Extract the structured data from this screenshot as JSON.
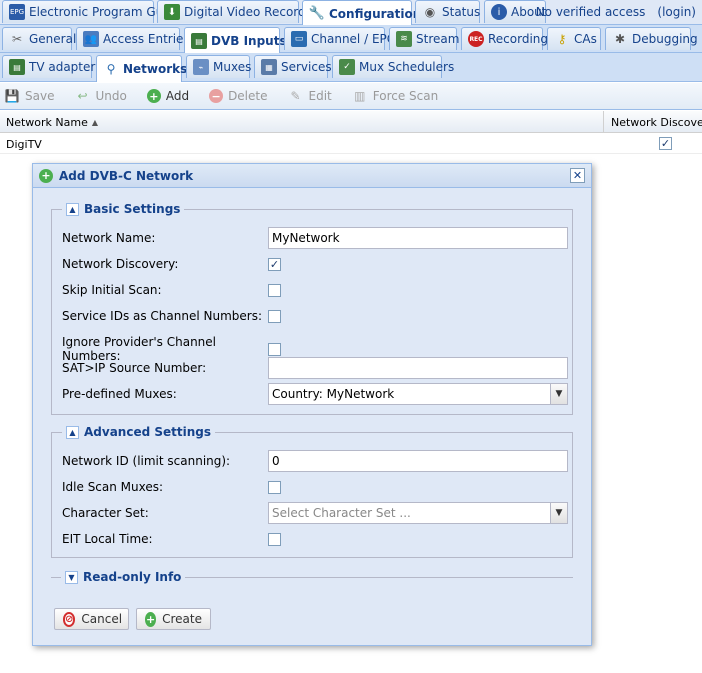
{
  "tabs_row1": [
    {
      "label": "Electronic Program Guide",
      "icon": "epg-icon"
    },
    {
      "label": "Digital Video Recorder",
      "icon": "download-icon"
    },
    {
      "label": "Configuration",
      "icon": "wrench-icon",
      "active": true
    },
    {
      "label": "Status",
      "icon": "eye-icon"
    },
    {
      "label": "About",
      "icon": "info-icon"
    }
  ],
  "access": {
    "status": "No verified access",
    "login": "(login)"
  },
  "tabs_row2": [
    {
      "label": "General",
      "icon": "tools-icon"
    },
    {
      "label": "Access Entries",
      "icon": "users-icon"
    },
    {
      "label": "DVB Inputs",
      "icon": "tv-card-icon",
      "active": true
    },
    {
      "label": "Channel / EPG",
      "icon": "television-icon"
    },
    {
      "label": "Stream",
      "icon": "stream-icon"
    },
    {
      "label": "Recording",
      "icon": "rec-icon"
    },
    {
      "label": "CAs",
      "icon": "key-icon"
    },
    {
      "label": "Debugging",
      "icon": "bug-icon"
    }
  ],
  "tabs_row3": [
    {
      "label": "TV adapters",
      "icon": "adapter-icon"
    },
    {
      "label": "Networks",
      "icon": "antenna-icon",
      "active": true
    },
    {
      "label": "Muxes",
      "icon": "mux-icon"
    },
    {
      "label": "Services",
      "icon": "services-icon"
    },
    {
      "label": "Mux Schedulers",
      "icon": "scheduler-icon"
    }
  ],
  "toolbar": {
    "save": "Save",
    "undo": "Undo",
    "add": "Add",
    "delete": "Delete",
    "edit": "Edit",
    "force_scan": "Force Scan"
  },
  "grid": {
    "columns": {
      "name": "Network Name",
      "discovery": "Network Discovery"
    },
    "rows": [
      {
        "name": "DigiTV",
        "discovery": true
      }
    ]
  },
  "dialog": {
    "title": "Add DVB-C Network",
    "basic": {
      "legend": "Basic Settings",
      "network_name_label": "Network Name:",
      "network_name_value": "MyNetwork",
      "network_discovery_label": "Network Discovery:",
      "network_discovery_checked": true,
      "skip_initial_scan_label": "Skip Initial Scan:",
      "skip_initial_scan_checked": false,
      "service_ids_label": "Service IDs as Channel Numbers:",
      "service_ids_checked": false,
      "ignore_provider_label": "Ignore Provider's Channel Numbers:",
      "ignore_provider_checked": false,
      "satip_label": "SAT>IP Source Number:",
      "satip_value": "",
      "predefined_label": "Pre-defined Muxes:",
      "predefined_value": "Country: MyNetwork"
    },
    "advanced": {
      "legend": "Advanced Settings",
      "network_id_label": "Network ID (limit scanning):",
      "network_id_value": "0",
      "idle_scan_label": "Idle Scan Muxes:",
      "idle_scan_checked": false,
      "charset_label": "Character Set:",
      "charset_placeholder": "Select Character Set ...",
      "eit_label": "EIT Local Time:",
      "eit_checked": false
    },
    "readonly": {
      "legend": "Read-only Info"
    },
    "buttons": {
      "cancel": "Cancel",
      "create": "Create"
    }
  },
  "colors": {
    "accent": "#15428b",
    "panel_bg": "#dfe8f6",
    "border": "#99bbe8"
  }
}
